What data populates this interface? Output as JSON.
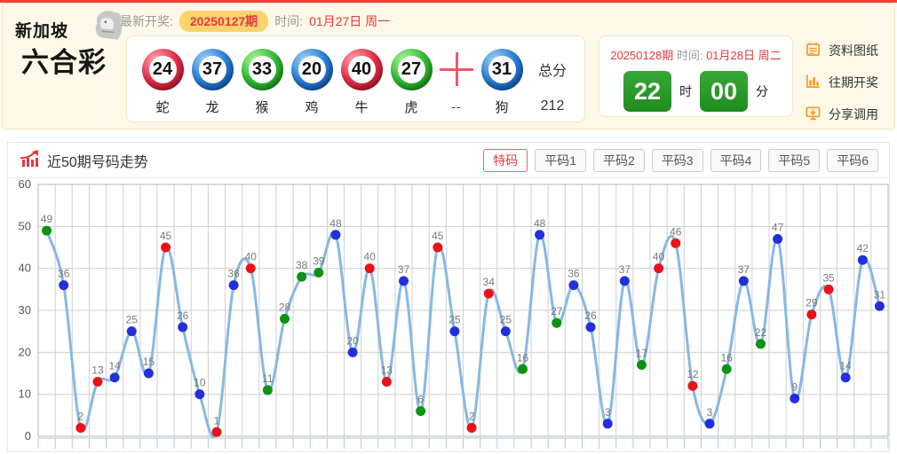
{
  "page": {
    "top_bar_color": "#f23c3c",
    "accent_red": "#e4393c",
    "accent_orange": "#f59b22"
  },
  "header": {
    "logo_line1": "新加坡",
    "logo_line2": "六合彩",
    "latest_label": "最新开奖:",
    "latest_issue": "20250127期",
    "time_label": "时间:",
    "latest_time": "01月27日 周一",
    "balls": [
      {
        "num": "24",
        "zodiac": "蛇",
        "color": "red"
      },
      {
        "num": "37",
        "zodiac": "龙",
        "color": "blue"
      },
      {
        "num": "33",
        "zodiac": "猴",
        "color": "green"
      },
      {
        "num": "20",
        "zodiac": "鸡",
        "color": "blue"
      },
      {
        "num": "40",
        "zodiac": "牛",
        "color": "red"
      },
      {
        "num": "27",
        "zodiac": "虎",
        "color": "green"
      },
      {
        "num": "31",
        "zodiac": "狗",
        "color": "blue"
      }
    ],
    "plus_sub": "--",
    "total_label": "总分",
    "total_value": "212",
    "countdown": {
      "issue": "20250128期",
      "time_label": "时间:",
      "date": "01月28日 周二",
      "hours": "22",
      "hours_unit": "时",
      "minutes": "00",
      "minutes_unit": "分"
    },
    "links": [
      {
        "label": "资料图纸",
        "icon": "document-icon"
      },
      {
        "label": "往期开奖",
        "icon": "bar-chart-icon"
      },
      {
        "label": "分享调用",
        "icon": "share-icon"
      }
    ]
  },
  "trend": {
    "title": "近50期号码走势",
    "title_icon": "trend-icon",
    "tabs": [
      {
        "label": "特码",
        "active": true
      },
      {
        "label": "平码1",
        "active": false
      },
      {
        "label": "平码2",
        "active": false
      },
      {
        "label": "平码3",
        "active": false
      },
      {
        "label": "平码4",
        "active": false
      },
      {
        "label": "平码5",
        "active": false
      },
      {
        "label": "平码6",
        "active": false
      }
    ]
  },
  "chart_data": {
    "type": "line",
    "title": "近50期号码走势",
    "xlabel": "",
    "ylabel": "",
    "ylim": [
      0,
      60
    ],
    "yticks": [
      0,
      10,
      20,
      30,
      40,
      50,
      60
    ],
    "grid": true,
    "legend_position": "none",
    "x_tick_labels": "none",
    "values": [
      49,
      36,
      2,
      13,
      14,
      25,
      15,
      45,
      26,
      10,
      1,
      36,
      40,
      11,
      28,
      38,
      39,
      48,
      20,
      40,
      13,
      37,
      6,
      45,
      25,
      2,
      34,
      25,
      16,
      48,
      27,
      36,
      26,
      3,
      37,
      17,
      40,
      46,
      12,
      3,
      16,
      37,
      22,
      47,
      9,
      29,
      35,
      14,
      42,
      31
    ],
    "point_colors": [
      "green",
      "blue",
      "red",
      "red",
      "blue",
      "blue",
      "blue",
      "red",
      "blue",
      "blue",
      "red",
      "blue",
      "red",
      "green",
      "green",
      "green",
      "green",
      "blue",
      "blue",
      "red",
      "red",
      "blue",
      "green",
      "red",
      "blue",
      "red",
      "red",
      "blue",
      "green",
      "blue",
      "green",
      "blue",
      "blue",
      "blue",
      "blue",
      "green",
      "red",
      "red",
      "red",
      "blue",
      "green",
      "blue",
      "green",
      "blue",
      "blue",
      "red",
      "red",
      "blue",
      "blue",
      "blue"
    ],
    "palette": {
      "red": "#e81318",
      "blue": "#2130dc",
      "green": "#0a9410"
    },
    "line_color": "#86b8e6",
    "grid_color": "#cfcfcf",
    "axis_tick_color": "#a9c9e8",
    "label_color": "#7a7a7a",
    "ytick_color": "#555555"
  }
}
